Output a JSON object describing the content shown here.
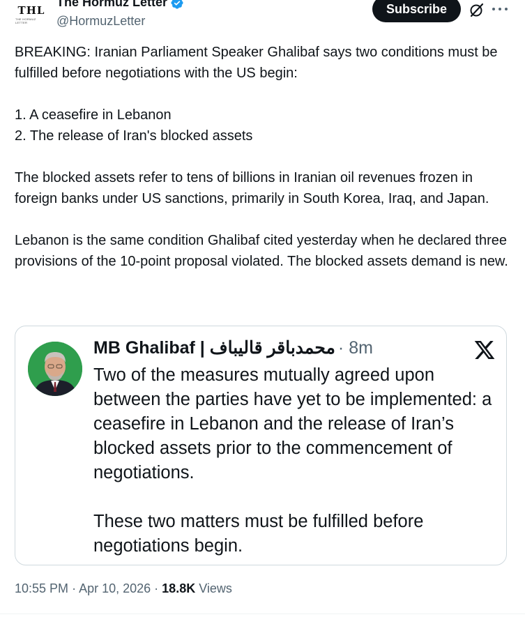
{
  "author": {
    "avatar_text": "THL",
    "avatar_subtext": "THE HORMUZ LETTER",
    "display_name": "The Hormuz Letter",
    "handle": "@HormuzLetter"
  },
  "actions": {
    "subscribe_label": "Subscribe"
  },
  "tweet": {
    "paragraphs": [
      "BREAKING: Iranian Parliament Speaker Ghalibaf says two conditions must be fulfilled before negotiations with the US begin:",
      "1. A ceasefire in Lebanon\n2. The release of Iran's blocked assets",
      "The blocked assets refer to tens of billions in Iranian oil revenues frozen in foreign banks under US sanctions, primarily in South Korea, Iraq, and Japan.",
      "Lebanon is the same condition Ghalibaf cited yesterday when he declared three provisions of the 10-point proposal violated. The blocked assets demand is new."
    ]
  },
  "embedded": {
    "name": "MB Ghalibaf | محمدباقر قالیباف",
    "meta": "· 8m",
    "paragraphs": [
      "Two of the measures mutually agreed upon between the parties have yet to be implemented: a ceasefire in Lebanon and the release of Iran’s blocked assets prior to the commencement of negotiations.",
      "These two matters must be fulfilled before negotiations begin."
    ]
  },
  "footer": {
    "time": "10:55 PM",
    "date": "Apr 10, 2026",
    "views_count": "18.8K",
    "views_label": "Views"
  },
  "colors": {
    "text": "#0f1419",
    "secondary": "#536471",
    "verified": "#1d9bf0",
    "border": "#cfd9de"
  }
}
